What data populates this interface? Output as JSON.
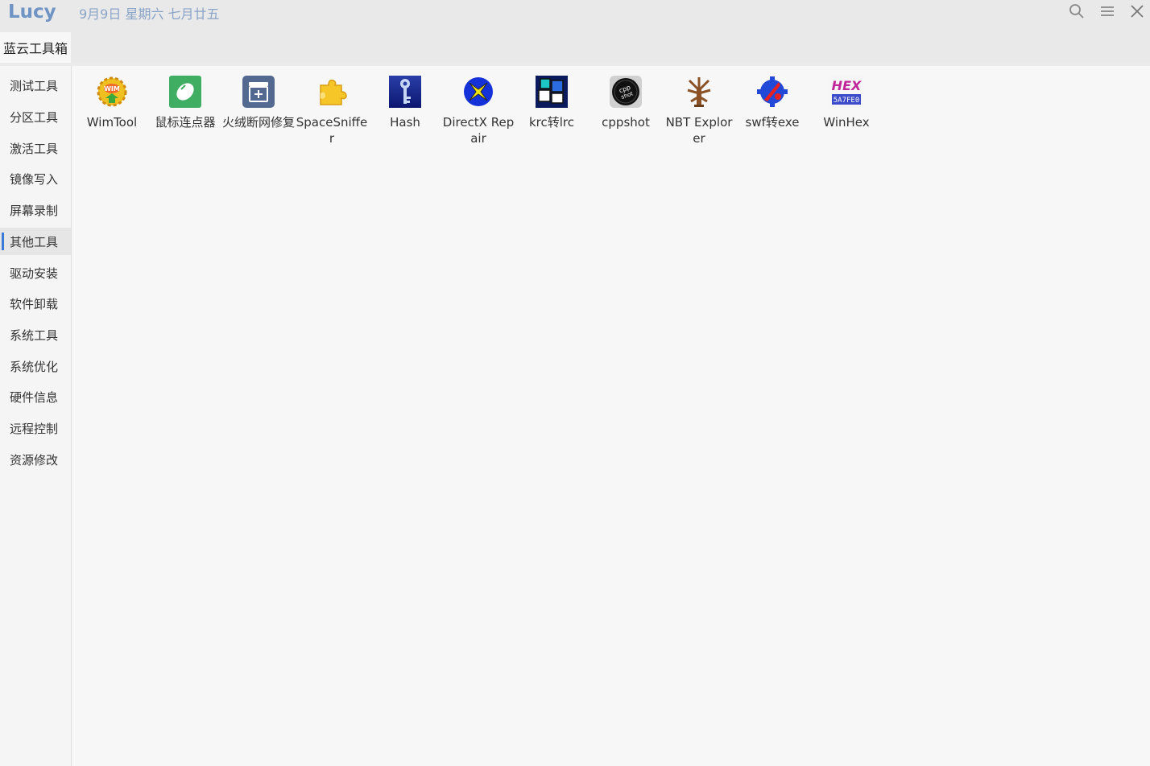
{
  "titlebar": {
    "app_name": "Lucy",
    "date": "9月9日 星期六 七月廿五"
  },
  "tabs": [
    {
      "label": "蓝云工具箱",
      "active": true
    }
  ],
  "sidebar": {
    "items": [
      {
        "label": "测试工具"
      },
      {
        "label": "分区工具"
      },
      {
        "label": "激活工具"
      },
      {
        "label": "镜像写入"
      },
      {
        "label": "屏幕录制"
      },
      {
        "label": "其他工具",
        "active": true
      },
      {
        "label": "驱动安装"
      },
      {
        "label": "软件卸载"
      },
      {
        "label": "系统工具"
      },
      {
        "label": "系统优化"
      },
      {
        "label": "硬件信息"
      },
      {
        "label": "远程控制"
      },
      {
        "label": "资源修改"
      }
    ]
  },
  "tools": [
    {
      "label": "WimTool",
      "icon": "wimtool-icon"
    },
    {
      "label": "鼠标连点器",
      "icon": "mouse-clicker-icon"
    },
    {
      "label": "火绒断网修复",
      "icon": "network-repair-icon"
    },
    {
      "label": "SpaceSniffer",
      "icon": "puzzle-icon"
    },
    {
      "label": "Hash",
      "icon": "hash-key-icon"
    },
    {
      "label": "DirectX Repair",
      "icon": "directx-repair-icon"
    },
    {
      "label": "krc转lrc",
      "icon": "krc-lrc-icon"
    },
    {
      "label": "cppshot",
      "icon": "cppshot-icon"
    },
    {
      "label": "NBT Explorer",
      "icon": "nbt-tree-icon"
    },
    {
      "label": "swf转exe",
      "icon": "swf-exe-icon"
    },
    {
      "label": "WinHex",
      "icon": "winhex-icon"
    }
  ],
  "colors": {
    "accent": "#3b7bd8",
    "logo": "#6f94c4",
    "date": "#8aa4c8"
  }
}
